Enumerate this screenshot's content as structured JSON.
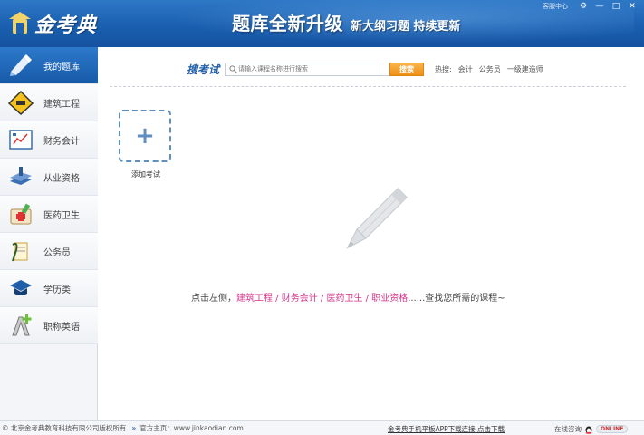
{
  "header": {
    "logo_text": "金考典",
    "banner_main": "题库全新升级",
    "banner_sub": "新大纲习题 持续更新",
    "service_label": "客服中心",
    "window_buttons": [
      "⚙",
      "—",
      "□",
      "✕"
    ]
  },
  "sidebar": {
    "items": [
      {
        "label": "我的题库",
        "icon": "my-bank-icon",
        "active": true
      },
      {
        "label": "建筑工程",
        "icon": "construction-sign-icon",
        "active": false
      },
      {
        "label": "财务会计",
        "icon": "accounting-board-icon",
        "active": false
      },
      {
        "label": "从业资格",
        "icon": "qualification-books-icon",
        "active": false
      },
      {
        "label": "医药卫生",
        "icon": "medical-kit-icon",
        "active": false
      },
      {
        "label": "公务员",
        "icon": "civil-servant-icon",
        "active": false
      },
      {
        "label": "学历类",
        "icon": "graduation-cap-icon",
        "active": false
      },
      {
        "label": "职称英语",
        "icon": "english-letter-icon",
        "active": false
      }
    ]
  },
  "search": {
    "title": "搜考试",
    "placeholder": "请输入课程名称进行搜索",
    "button_label": "搜索",
    "hot_label": "热搜:",
    "hot_terms": [
      "会计",
      "公务员",
      "一级建造师"
    ]
  },
  "main": {
    "add_exam_label": "添加考试",
    "tip_prefix": "点击左侧，",
    "tip_links": [
      "建筑工程",
      "财务会计",
      "医药卫生",
      "职业资格"
    ],
    "tip_sep": " / ",
    "tip_suffix": "......查找您所需的课程~"
  },
  "footer": {
    "copyright": "© 北京金考典教育科技有限公司版权所有",
    "site_label": "官方主页：www.jinkaodian.com",
    "download_text": "金考典手机平板APP下载连接  点击下载",
    "online_label": "在线咨询",
    "online_badge": "ONLINE"
  },
  "colors": {
    "header_blue": "#1a5fb0",
    "active_blue": "#2d79cb",
    "accent_orange": "#ee8f15",
    "link_pink": "#d6348a",
    "dashed_blue": "#5e8fbf"
  }
}
